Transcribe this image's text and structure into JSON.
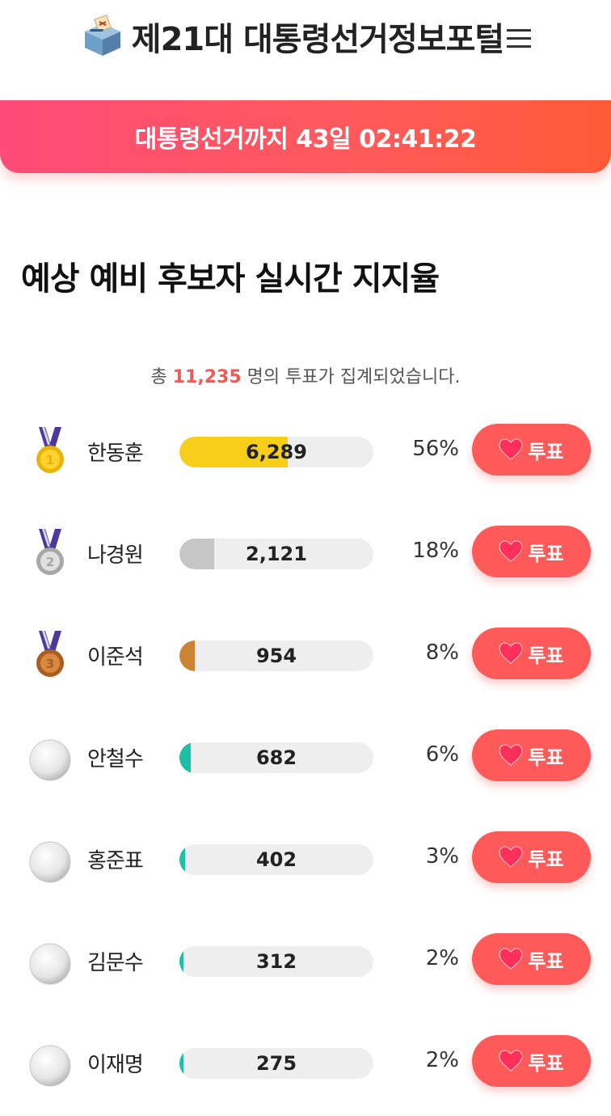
{
  "header": {
    "title": "제21대 대통령선거정보포털"
  },
  "banner": {
    "text": "대통령선거까지 43일 02:41:22"
  },
  "section": {
    "title": "예상 예비 후보자 실시간 지지율"
  },
  "total": {
    "prefix": "총 ",
    "count": "11,235",
    "suffix": " 명의 투표가 집계되었습니다."
  },
  "vote_label": "투표",
  "candidates": [
    {
      "name": "한동훈",
      "count": "6,289",
      "percent": "56%",
      "share": 0.56,
      "medal": "gold-medal",
      "color": "#f7cf1a"
    },
    {
      "name": "나경원",
      "count": "2,121",
      "percent": "18%",
      "share": 0.18,
      "medal": "silver-medal",
      "color": "#c6c6c6"
    },
    {
      "name": "이준석",
      "count": "954",
      "percent": "8%",
      "share": 0.08,
      "medal": "bronze-medal",
      "color": "#cd8333"
    },
    {
      "name": "안철수",
      "count": "682",
      "percent": "6%",
      "share": 0.06,
      "medal": "white-ball",
      "color": "#1dbfa8"
    },
    {
      "name": "홍준표",
      "count": "402",
      "percent": "3%",
      "share": 0.03,
      "medal": "white-ball",
      "color": "#1dbfa8"
    },
    {
      "name": "김문수",
      "count": "312",
      "percent": "2%",
      "share": 0.02,
      "medal": "white-ball",
      "color": "#1dbfa8"
    },
    {
      "name": "이재명",
      "count": "275",
      "percent": "2%",
      "share": 0.02,
      "medal": "white-ball",
      "color": "#1dbfa8"
    }
  ]
}
